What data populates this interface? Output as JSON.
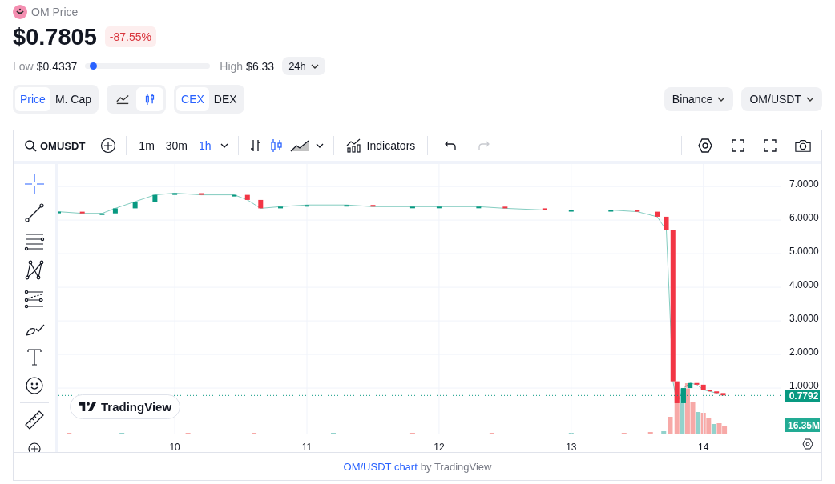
{
  "header": {
    "title": "OM Price",
    "price": "$0.7805",
    "change": "-87.55%",
    "low_label": "Low",
    "low": "$0.4337",
    "high_label": "High",
    "high": "$6.33",
    "range": {
      "level": 0.06
    },
    "period": "24h"
  },
  "view_toggle": [
    {
      "label": "Price",
      "selected": true
    },
    {
      "label": "M. Cap",
      "selected": false
    }
  ],
  "style_toggle": [
    {
      "kind": "line",
      "selected": false
    },
    {
      "kind": "candles",
      "selected": true
    }
  ],
  "market_toggle": [
    {
      "label": "CEX",
      "selected": true
    },
    {
      "label": "DEX",
      "selected": false
    }
  ],
  "exchange": "Binance",
  "pair": "OM/USDT",
  "toolbar": {
    "symbol": "OMUSDT",
    "intervals": [
      {
        "label": "1m",
        "selected": false
      },
      {
        "label": "30m",
        "selected": false
      },
      {
        "label": "1h",
        "selected": true
      }
    ],
    "styles": [
      {
        "kind": "bars",
        "selected": false
      },
      {
        "kind": "candles",
        "selected": true
      },
      {
        "kind": "area",
        "selected": false
      }
    ],
    "indicators": "Indicators",
    "redo_disabled": true
  },
  "tools": [
    {
      "kind": "crosshair",
      "selected": true
    },
    {
      "kind": "trendline",
      "selected": false
    },
    {
      "kind": "fib",
      "selected": false
    },
    {
      "kind": "pattern",
      "selected": false
    },
    {
      "kind": "projection",
      "selected": false
    },
    {
      "kind": "brush",
      "selected": false
    },
    {
      "kind": "text",
      "selected": false
    },
    {
      "kind": "emoji",
      "selected": false
    },
    {
      "kind": "ruler",
      "selected": false
    },
    {
      "kind": "zoom",
      "selected": false
    }
  ],
  "chart": {
    "watermark": "TradingView",
    "volume": "16.35M",
    "chart_data": {
      "type": "line",
      "grid": true,
      "ref_lines": [
        {
          "axis": "y",
          "value": 0.7792,
          "label": "0.7792",
          "color": "#089981"
        }
      ],
      "series": [
        {
          "color": "#089981",
          "values": [
            6.25,
            6.2,
            6.2,
            6.35,
            6.55,
            6.75,
            6.8,
            6.75,
            6.75,
            6.6,
            6.35,
            6.4,
            6.45,
            6.45,
            6.4,
            6.4,
            6.4,
            6.4,
            6.35,
            6.3,
            6.3,
            6.3,
            6.25,
            6.1,
            5.7,
            1.2,
            0.55,
            1.0,
            1.15,
            1.1,
            0.95,
            0.9,
            0.85,
            0.78
          ]
        }
      ],
      "x": [
        9.12,
        9.3,
        9.45,
        9.55,
        9.7,
        9.85,
        10.0,
        10.2,
        10.45,
        10.55,
        10.65,
        10.8,
        11.0,
        11.3,
        11.5,
        11.8,
        12.0,
        12.3,
        12.5,
        12.8,
        13.0,
        13.3,
        13.5,
        13.65,
        13.72,
        13.77,
        13.8,
        13.85,
        13.9,
        13.95,
        14.0,
        14.05,
        14.1,
        14.15
      ],
      "xlim": [
        9.12,
        14.59
      ],
      "ylim": [
        -0.38,
        7.67
      ],
      "xticks": [
        10,
        11,
        12,
        13,
        14
      ],
      "yticks": [
        {
          "value": 1,
          "label": "1.0000"
        },
        {
          "value": 2,
          "label": "2.0000"
        },
        {
          "value": 3,
          "label": "3.0000"
        },
        {
          "value": 4,
          "label": "4.0000"
        },
        {
          "value": 5,
          "label": "5.0000"
        },
        {
          "value": 6,
          "label": "6.0000"
        },
        {
          "value": 7,
          "label": "7.0000"
        }
      ]
    }
  },
  "footer": {
    "link": "OM/USDT chart",
    "suffix": "by TradingView"
  }
}
